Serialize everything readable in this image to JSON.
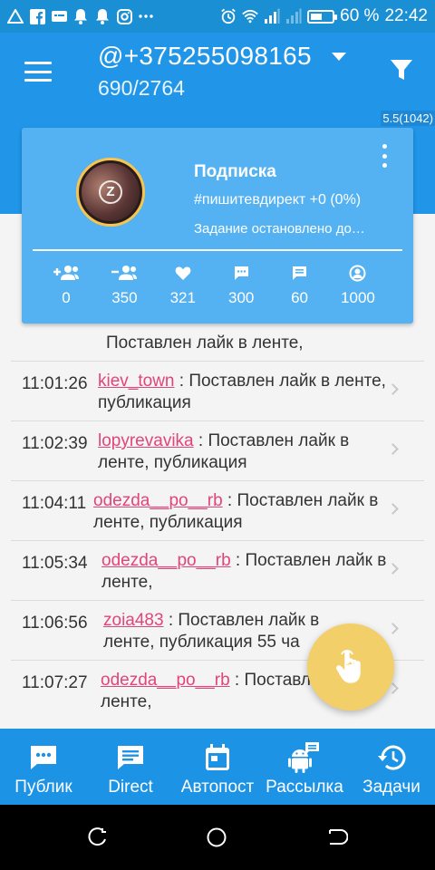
{
  "status_bar": {
    "battery_text": "60 %",
    "time": "22:42",
    "battery_level": 0.6,
    "icons": [
      "alert-triangle-icon",
      "facebook-icon",
      "message-icon",
      "bell-icon",
      "bell-icon",
      "instagram-icon",
      "dots-icon",
      "alarm-icon",
      "wifi-icon",
      "signal-icon",
      "signal-icon",
      "battery-icon"
    ]
  },
  "app_bar": {
    "account": "@+375255098165",
    "count": "690/2764"
  },
  "version": "5.5(1042)",
  "task_card": {
    "title": "Подписка",
    "tag": "#пишитевдирект +0 (0%)",
    "status": "Задание остановлено до…",
    "avatar_letter": "Z",
    "stats": [
      {
        "icon": "follow-icon",
        "value": "0"
      },
      {
        "icon": "unfollow-icon",
        "value": "350"
      },
      {
        "icon": "heart-icon",
        "value": "321"
      },
      {
        "icon": "comment-icon",
        "value": "300"
      },
      {
        "icon": "message-icon",
        "value": "60"
      },
      {
        "icon": "stories-icon",
        "value": "1000"
      }
    ]
  },
  "log": {
    "head": "Поставлен лайк в ленте,",
    "rows": [
      {
        "time": "11:01:26",
        "user": "kiev_town",
        "text": " : Поставлен лайк в ленте, публикация"
      },
      {
        "time": "11:02:39",
        "user": "lopyrevavika",
        "text": " : Поставлен лайк в ленте, публикация"
      },
      {
        "time": "11:04:11",
        "user": "odezda__po__rb",
        "text": " : Поставлен лайк в ленте, публикация"
      },
      {
        "time": "11:05:34",
        "user": "odezda__po__rb",
        "text": " : Поставлен лайк в ленте,"
      },
      {
        "time": "11:06:56",
        "user": "zoia483",
        "text": " : Поставлен лайк в ленте, публикация 55 ча"
      },
      {
        "time": "11:07:27",
        "user": "odezda__po__rb",
        "text": " : Поставлен лайк в ленте,"
      }
    ]
  },
  "bottom_nav": [
    {
      "icon": "chat-icon",
      "label": "Публик"
    },
    {
      "icon": "direct-icon",
      "label": "Direct"
    },
    {
      "icon": "calendar-icon",
      "label": "Автопост"
    },
    {
      "icon": "android-icon",
      "label": "Рассылка"
    },
    {
      "icon": "history-icon",
      "label": "Задачи"
    }
  ],
  "colors": {
    "primary": "#2196e8",
    "card": "#54b2f3",
    "username": "#e0457b",
    "fab": "#f3cf69"
  }
}
